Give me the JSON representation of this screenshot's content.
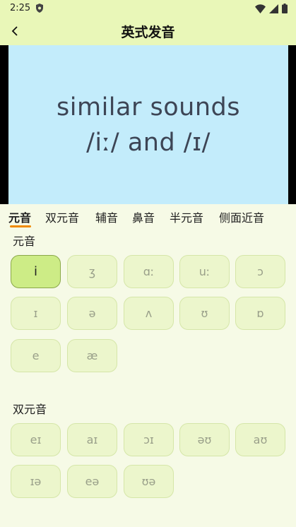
{
  "status": {
    "time": "2:25"
  },
  "header": {
    "title": "英式发音"
  },
  "video": {
    "line1": "similar sounds",
    "line2": "/iː/ and /ɪ/"
  },
  "tabs": [
    "元音",
    "双元音",
    "辅音",
    "鼻音",
    "半元音",
    "侧面近音"
  ],
  "sections": [
    {
      "title": "元音",
      "items": [
        "i",
        "ʒ",
        "ɑː",
        "uː",
        "ɔ",
        "ɪ",
        "ə",
        "ʌ",
        "ʊ",
        "ɒ",
        "e",
        "æ"
      ]
    },
    {
      "title": "双元音",
      "items": [
        "eɪ",
        "aɪ",
        "ɔɪ",
        "əʊ",
        "aʊ",
        "ɪə",
        "eə",
        "ʊə"
      ]
    }
  ],
  "colors": {
    "accent": "#f08a00",
    "header_bg": "#e9f7b8",
    "video_bg": "#c3ecfb"
  }
}
